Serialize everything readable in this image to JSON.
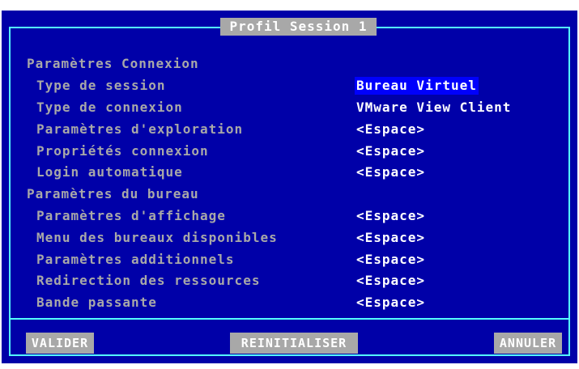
{
  "dialog": {
    "title": "Profil Session 1"
  },
  "sections": {
    "connexion": "Paramètres Connexion",
    "bureau": "Paramètres du bureau"
  },
  "rows": [
    {
      "label": "Type de session",
      "value": "Bureau Virtuel"
    },
    {
      "label": "Type de connexion",
      "value": "VMware View Client"
    },
    {
      "label": "Paramètres d'exploration",
      "value": "<Espace>"
    },
    {
      "label": "Propriétés connexion",
      "value": "<Espace>"
    },
    {
      "label": "Login automatique",
      "value": "<Espace>"
    },
    {
      "label": "Paramètres d'affichage",
      "value": "<Espace>"
    },
    {
      "label": "Menu des bureaux disponibles",
      "value": "<Espace>"
    },
    {
      "label": "Paramètres additionnels",
      "value": "<Espace>"
    },
    {
      "label": "Redirection des ressources",
      "value": "<Espace>"
    },
    {
      "label": "Bande passante",
      "value": "<Espace>"
    }
  ],
  "buttons": {
    "validate": "VALIDER",
    "reset": "REINITIALISER",
    "cancel": "ANNULER"
  },
  "colors": {
    "background": "#0000a8",
    "frame": "#54fcfc",
    "label_text": "#a8a8a8",
    "value_text": "#ffffff",
    "selection": "#0000fc",
    "button_bg": "#a8a8a8"
  }
}
